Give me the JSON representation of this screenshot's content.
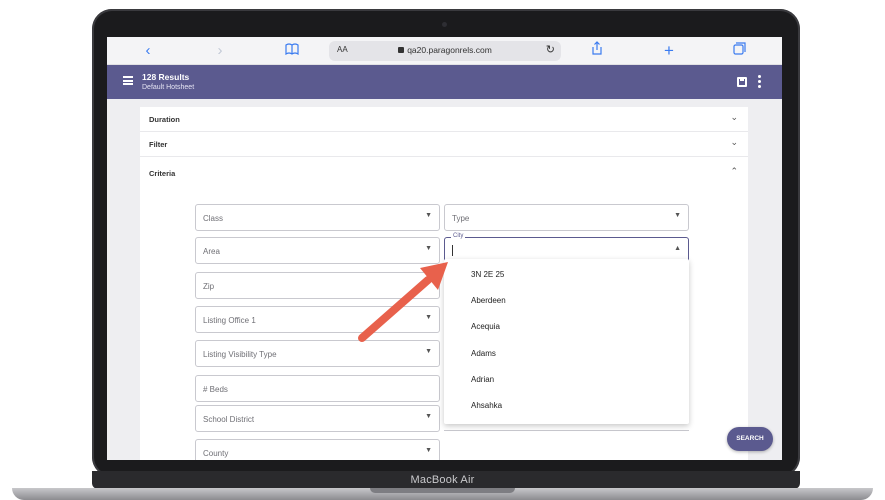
{
  "device": {
    "brand_label": "MacBook Air"
  },
  "browser": {
    "url": "qa20.paragonrels.com",
    "aa_label": "AA",
    "icons": [
      "back-icon",
      "forward-icon",
      "bookmarks-icon",
      "lock-icon",
      "reload-icon",
      "share-icon",
      "new-tab-icon",
      "tabs-icon"
    ]
  },
  "header": {
    "results": "128 Results",
    "subtitle": "Default Hotsheet",
    "icons": [
      "menu-icon",
      "save-icon",
      "more-icon"
    ]
  },
  "accordion": [
    {
      "label": "Duration",
      "state": "collapsed"
    },
    {
      "label": "Filter",
      "state": "collapsed"
    },
    {
      "label": "Criteria",
      "state": "expanded"
    }
  ],
  "criteria": {
    "class": "Class",
    "type": "Type",
    "area": "Area",
    "city_label": "City",
    "zip": "Zip",
    "listing_office": "Listing Office 1",
    "listing_visibility": "Listing Visibility Type",
    "beds": "# Beds",
    "school_district": "School District",
    "county": "County"
  },
  "city_options": [
    "3N 2E 25",
    "Aberdeen",
    "Acequia",
    "Adams",
    "Adrian",
    "Ahsahka"
  ],
  "search_button": "SEARCH",
  "colors": {
    "brand": "#5b5a8f",
    "arrow": "#e8614c"
  }
}
